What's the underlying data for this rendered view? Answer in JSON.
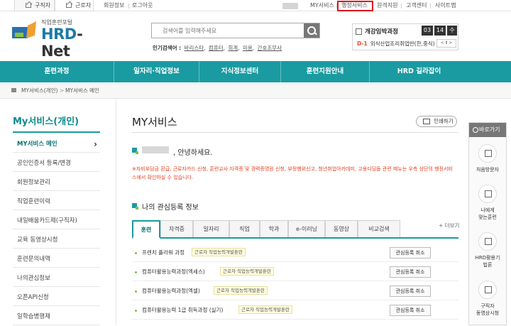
{
  "topbar": {
    "tab_jobseeker": "구직자",
    "tab_worker": "근로자",
    "links": [
      "회원정보",
      "로그아웃"
    ],
    "right_links": [
      "MY서비스",
      "행정서비스",
      "원격지원",
      "고객센터",
      "사이트맵"
    ]
  },
  "header": {
    "logo_sub": "직업훈련포털",
    "logo_main_a": "HRD",
    "logo_main_b": "-Net",
    "search_placeholder": "검색어를 입력해주세요",
    "popular_label": "인기검색어 :",
    "popular_terms": [
      "바리스타",
      "컴퓨터",
      "회계",
      "미용",
      "간호조무사"
    ],
    "countdown_label": "개강임박과정",
    "countdown_digits": [
      "03",
      "14",
      "수"
    ],
    "countdown_dday": "D-1",
    "countdown_course": "외식산업조리취업반(한,중식)",
    "countdown_nav": "< Ⅱ >"
  },
  "nav": [
    "훈련과정",
    "일자리·직업정보",
    "지식정보센터",
    "훈련지원안내",
    "HRD 길라잡이"
  ],
  "breadcrumb": [
    "MY서비스(개인)",
    ">",
    "MY서비스 메인"
  ],
  "sidebar": {
    "title": "My서비스(개인)",
    "items": [
      "MY서비스 메인",
      "공인인증서 등록/변경",
      "회원정보관리",
      "직업훈련이력",
      "내일배움카드제(구직자)",
      "교육 동영상시청",
      "훈련문의내역",
      "나의관심정보",
      "오픈API신청",
      "일학습병행제"
    ]
  },
  "main": {
    "title": "MY서비스",
    "print_label": "인쇄하기",
    "hello": ", 안녕하세요.",
    "notice": "※자비부담금 환급, 근로자카드 신청, 훈련교사 자격증 및 경력증명원 신청, 부정행위신고, 청년취업아카데미, 고용디딤돌 관련 메뉴는 우측 상단의 행정서비스에서 확인하실 수 있습니다.",
    "section_title": "나의 관심등록 정보",
    "more_label": "+ 더보기",
    "tabs": [
      "훈련",
      "자격증",
      "일자리",
      "직업",
      "학과",
      "e-이러닝",
      "동영상",
      "비교검색"
    ],
    "rows": [
      {
        "name": "프렌치 플라워 과정",
        "tag": "근로자 직업능력개발훈련",
        "button": "관심등록 취소"
      },
      {
        "name": "컴퓨터활용능력과정(엑세스)",
        "tag": "근로자 직업능력개발훈련",
        "button": "관심등록 취소"
      },
      {
        "name": "컴퓨터활용능력과정(엑셀)",
        "tag": "근로자 직업능력개발훈련",
        "button": "관심등록 취소"
      },
      {
        "name": "컴퓨터활용능력 1급 취득과정 (실기)",
        "tag": "근로자 직업능력개발훈련",
        "button": "관심등록 취소"
      }
    ]
  },
  "quick": {
    "header": "바로가기",
    "items": [
      "처음방문자",
      "나에게\n맞는훈련",
      "HRD활용기\n법론",
      "구직자\n동영상시청"
    ]
  },
  "colors": {
    "primary": "#1a9ba1",
    "highlight": "#e0141d",
    "notice": "#e04020"
  }
}
